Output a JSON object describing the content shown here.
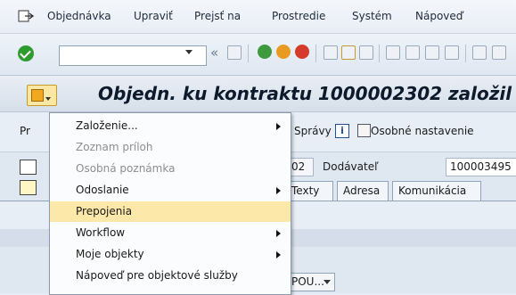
{
  "menubar": {
    "items": [
      "Objednávka",
      "Upraviť",
      "Prejsť na",
      "Prostredie",
      "Systém",
      "Nápoveď"
    ]
  },
  "toolbar": {
    "command_field_value": "",
    "nav_prev": "«"
  },
  "title": "Objedn. ku kontraktu 1000002302 založil",
  "app": {
    "pr_label": "Pr",
    "spravy_label": "Správy",
    "info_glyph": "i",
    "personal_settings_label": "Osobné nastavenie",
    "doc_number_value": "02",
    "vendor_label": "Dodávateľ",
    "vendor_value": "100003495",
    "tabs": [
      "Texty",
      "Adresa",
      "Komunikácia"
    ],
    "pou_label": "POU..."
  },
  "menu": {
    "items": [
      {
        "label": "Založenie...",
        "submenu": true,
        "enabled": true,
        "highlighted": false
      },
      {
        "label": "Zoznam príloh",
        "submenu": false,
        "enabled": false,
        "highlighted": false
      },
      {
        "label": "Osobná poznámka",
        "submenu": false,
        "enabled": false,
        "highlighted": false
      },
      {
        "label": "Odoslanie",
        "submenu": true,
        "enabled": true,
        "highlighted": false
      },
      {
        "label": "Prepojenia",
        "submenu": false,
        "enabled": true,
        "highlighted": true
      },
      {
        "label": "Workflow",
        "submenu": true,
        "enabled": true,
        "highlighted": false
      },
      {
        "label": "Moje objekty",
        "submenu": true,
        "enabled": true,
        "highlighted": false
      },
      {
        "label": "Nápoveď pre objektové služby",
        "submenu": false,
        "enabled": true,
        "highlighted": false
      }
    ]
  },
  "colors": {
    "menu_highlight": "#fce8a9",
    "menu_disabled_text": "#8e8e8e",
    "title_text": "#0d1a2b",
    "check_green": "#2f9b2f"
  }
}
